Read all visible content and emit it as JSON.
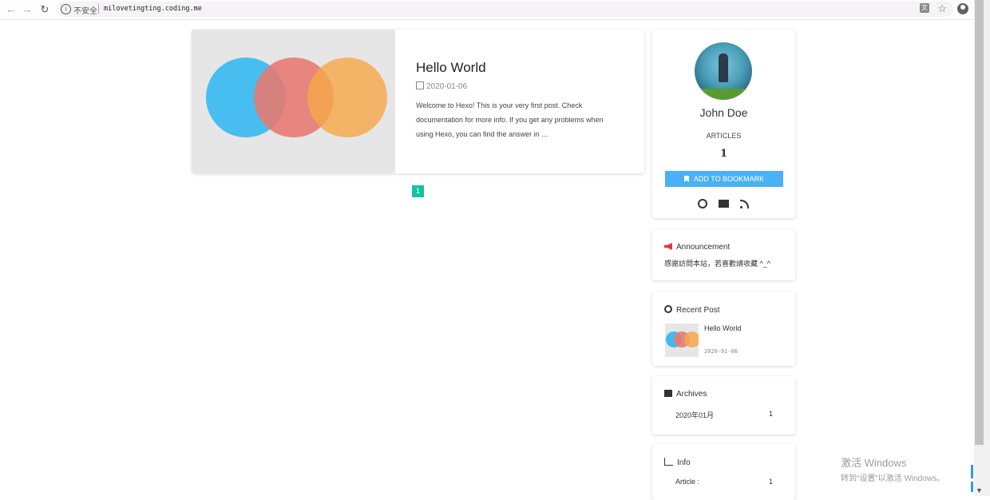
{
  "browser": {
    "security_label": "不安全",
    "url": "milovetingting.coding.me"
  },
  "post": {
    "title": "Hello World",
    "date": "2020-01-06",
    "excerpt": "Welcome to Hexo! This is your very first post. Check documentation for more info. If you get any problems when using Hexo, you can find the answer in ..."
  },
  "pagination": {
    "current": "1"
  },
  "profile": {
    "name": "John Doe",
    "articles_label": "ARTICLES",
    "articles_count": "1",
    "bookmark_label": "ADD TO BOOKMARK"
  },
  "announcement": {
    "title": "Announcement",
    "text": "感謝訪問本站，若喜歡請收藏 ^_^"
  },
  "recent": {
    "title": "Recent Post",
    "items": [
      {
        "title": "Hello World",
        "date": "2020-01-06"
      }
    ]
  },
  "archives": {
    "title": "Archives",
    "items": [
      {
        "label": "2020年01月",
        "count": "1"
      }
    ]
  },
  "info": {
    "title": "Info",
    "items": [
      {
        "label": "Article :",
        "count": "1"
      }
    ]
  },
  "watermark": {
    "line1": "激活 Windows",
    "line2": "转到“设置”以激活 Windows。"
  },
  "colors": {
    "accent": "#49b1f5",
    "pager": "#14c3a2",
    "announce_icon": "#e33333"
  }
}
